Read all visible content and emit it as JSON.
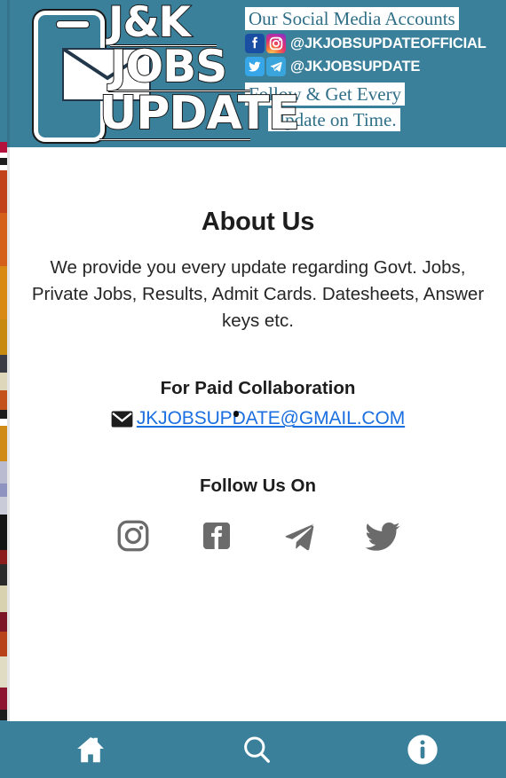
{
  "theme": {
    "brand_teal": "#3a809b",
    "link_blue": "#1b6fe0",
    "social_icon_gray": "#6b6b6b",
    "text_dark": "#1d1d1d"
  },
  "header": {
    "logo": {
      "line1": "J&K",
      "line2": "JOBS",
      "line3": "UPDATE",
      "alt": "J&K Jobs Update"
    },
    "social_heading": "Our Social Media Accounts",
    "accounts": [
      {
        "handle": "@JKJOBSUPDATEOFFICIAL",
        "platforms": [
          "facebook",
          "instagram"
        ]
      },
      {
        "handle": "@JKJOBSUPDATE",
        "platforms": [
          "twitter",
          "telegram"
        ]
      }
    ],
    "tagline_line1": "Follow & Get Every",
    "tagline_line2": "Update on Time."
  },
  "main": {
    "about_title": "About Us",
    "about_body": "We provide you every update regarding Govt. Jobs, Private Jobs, Results, Admit Cards. Datesheets, Answer keys etc.",
    "collab_title": "For Paid Collaboration",
    "email": "JKJOBSUPDATE@GMAIL.COM",
    "follow_title": "Follow Us On",
    "social_links": [
      {
        "name": "instagram",
        "label": "Instagram"
      },
      {
        "name": "facebook",
        "label": "Facebook"
      },
      {
        "name": "telegram",
        "label": "Telegram"
      },
      {
        "name": "twitter",
        "label": "Twitter"
      }
    ]
  },
  "bottom_nav": {
    "items": [
      {
        "name": "home",
        "label": "Home"
      },
      {
        "name": "search",
        "label": "Search"
      },
      {
        "name": "info",
        "label": "Info"
      }
    ]
  }
}
